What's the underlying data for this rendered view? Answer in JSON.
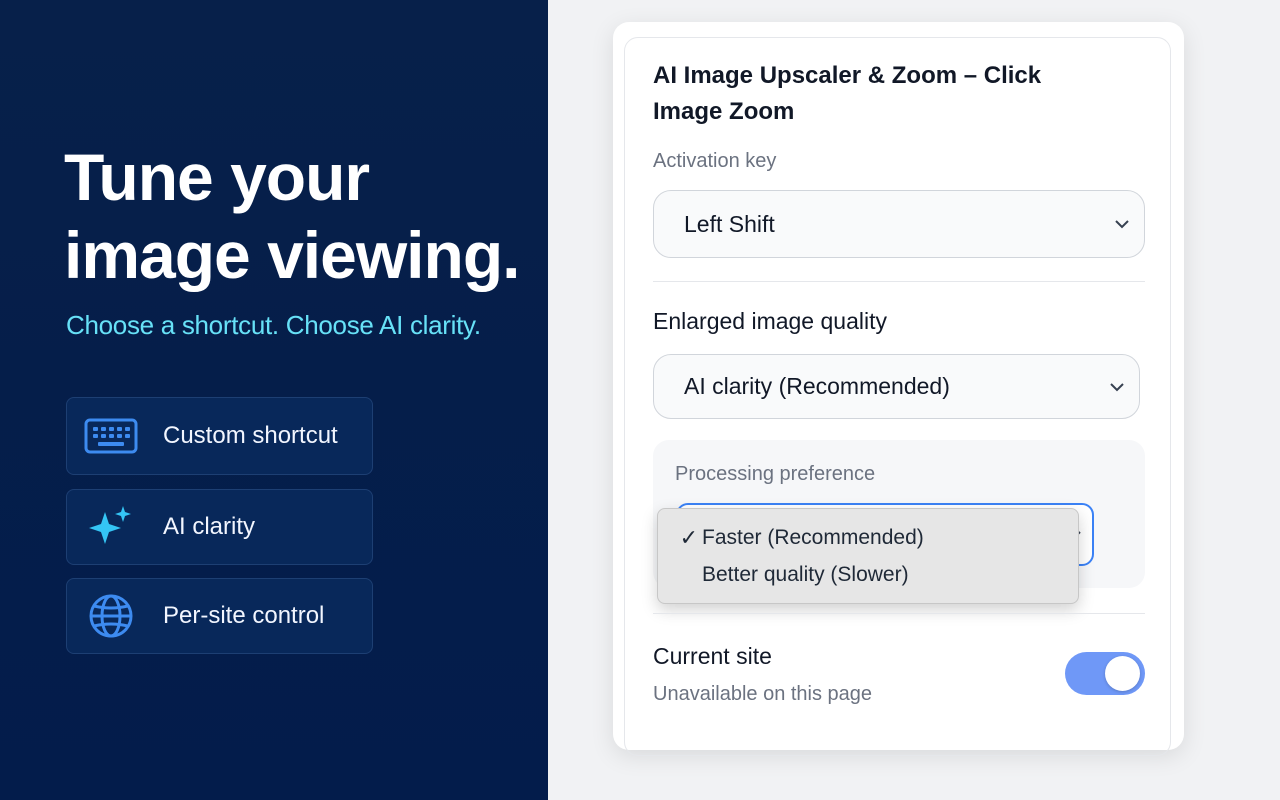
{
  "hero": {
    "headline_line1": "Tune your",
    "headline_line2": "image viewing.",
    "subline": "Choose a shortcut. Choose AI clarity."
  },
  "features": [
    {
      "label": "Custom shortcut",
      "icon": "keyboard-icon"
    },
    {
      "label": "AI clarity",
      "icon": "sparkles-icon"
    },
    {
      "label": "Per-site control",
      "icon": "globe-icon"
    }
  ],
  "popup": {
    "title": "AI Image Upscaler & Zoom – Click Image Zoom",
    "activation_key": {
      "label": "Activation key",
      "value": "Left Shift"
    },
    "quality": {
      "label": "Enlarged image quality",
      "value": "AI clarity (Recommended)"
    },
    "processing": {
      "label": "Processing preference",
      "options": [
        {
          "label": "Faster (Recommended)",
          "selected": true
        },
        {
          "label": "Better quality (Slower)",
          "selected": false
        }
      ]
    },
    "current_site": {
      "label": "Current site",
      "status": "Unavailable on this page",
      "enabled": true
    }
  },
  "colors": {
    "left_bg": "#031c4b",
    "accent_cyan": "#67e1f7",
    "icon_blue": "#3d8bf0",
    "toggle_on": "#6f98f7",
    "focus_blue": "#3b82f6"
  }
}
